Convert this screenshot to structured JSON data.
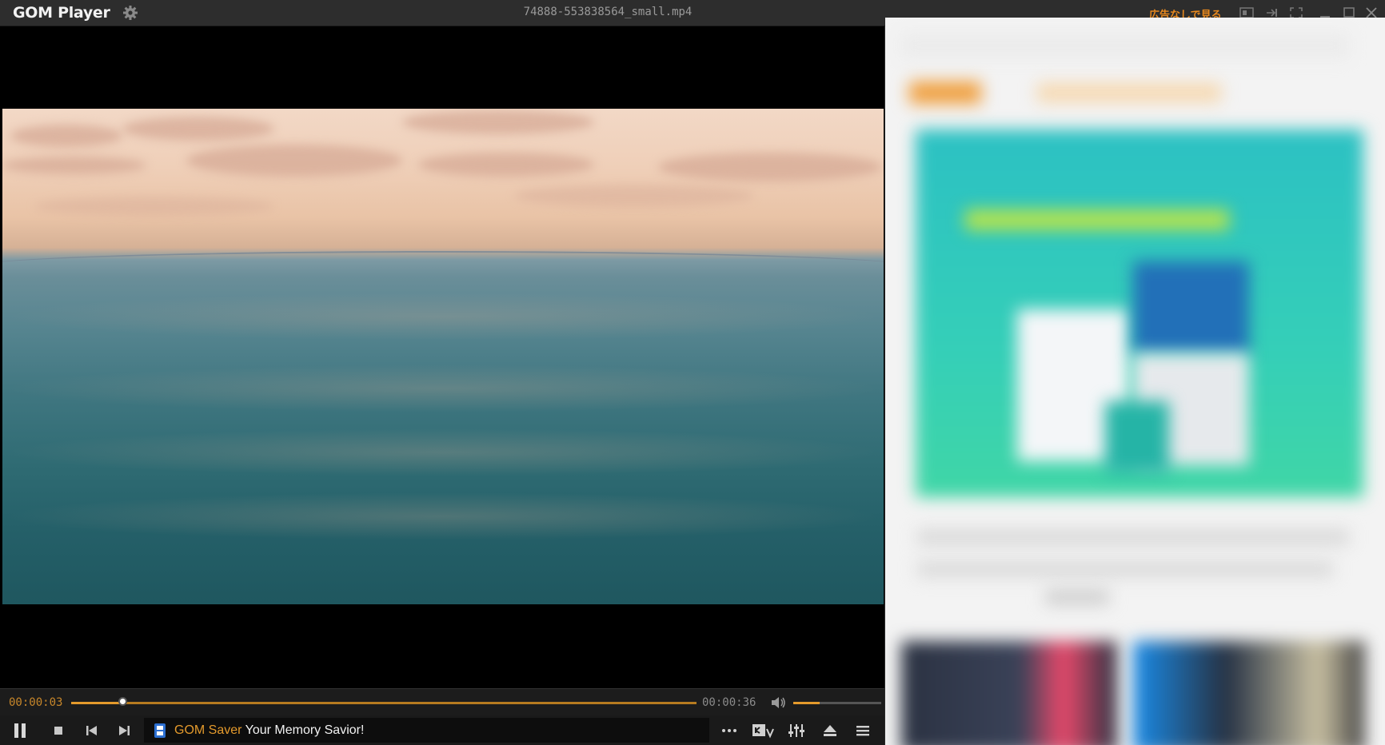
{
  "app": {
    "logo_text": "GOM Player",
    "filename": "74888-553838564_small.mp4",
    "ad_label": "広告なしで見る"
  },
  "player": {
    "current_time": "00:00:03",
    "total_time": "00:00:36",
    "progress_fraction": 0.083,
    "volume_fraction": 0.3
  },
  "promo": {
    "brand": "GOM Saver",
    "tagline": " Your Memory Savior!"
  },
  "icons": {
    "settings": "gear-icon",
    "pause": "pause-icon",
    "stop": "stop-icon",
    "prev": "skip-previous-icon",
    "next": "skip-next-icon",
    "more": "more-icon",
    "subtitle": "subtitle-icon",
    "equalizer": "equalizer-icon",
    "eject": "eject-icon",
    "menu": "menu-icon",
    "volume": "volume-icon"
  },
  "colors": {
    "accent": "#e49a2c",
    "background": "#2b2b2b"
  }
}
